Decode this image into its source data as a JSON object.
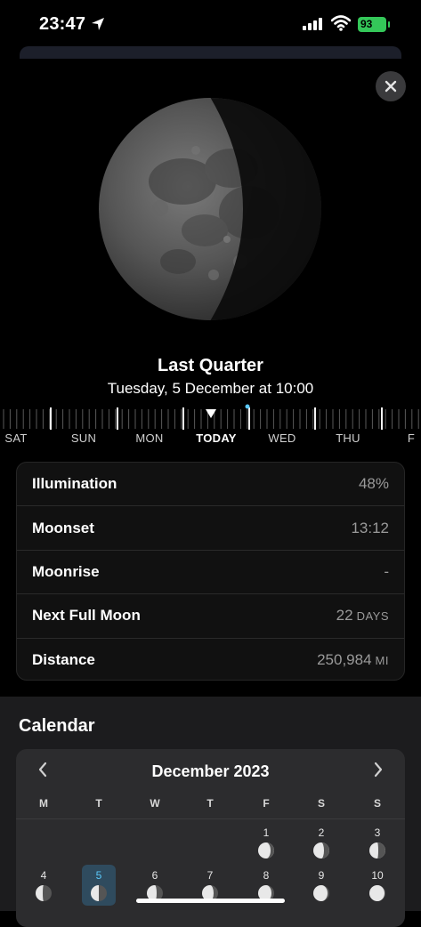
{
  "status_bar": {
    "time": "23:47",
    "battery": "93"
  },
  "moon_detail": {
    "phase_name": "Last Quarter",
    "date_time": "Tuesday, 5 December at 10:00",
    "illumination_fraction": 0.48
  },
  "timeline": {
    "days": [
      "SAT",
      "SUN",
      "MON",
      "TODAY",
      "WED",
      "THU",
      "F"
    ],
    "today_index": 3
  },
  "stats": [
    {
      "label": "Illumination",
      "value": "48%",
      "unit": ""
    },
    {
      "label": "Moonset",
      "value": "13:12",
      "unit": ""
    },
    {
      "label": "Moonrise",
      "value": "-",
      "unit": ""
    },
    {
      "label": "Next Full Moon",
      "value": "22",
      "unit": "DAYS"
    },
    {
      "label": "Distance",
      "value": "250,984",
      "unit": "MI"
    }
  ],
  "calendar": {
    "heading": "Calendar",
    "month_title": "December 2023",
    "weekdays": [
      "M",
      "T",
      "W",
      "T",
      "F",
      "S",
      "S"
    ],
    "week1": [
      "1",
      "2",
      "3"
    ],
    "week2": [
      "4",
      "5",
      "6",
      "7",
      "8",
      "9",
      "10"
    ],
    "selected_day": "5"
  },
  "colors": {
    "accent": "#5ac8fa",
    "battery": "#34c759",
    "card": "#2c2c2e"
  }
}
